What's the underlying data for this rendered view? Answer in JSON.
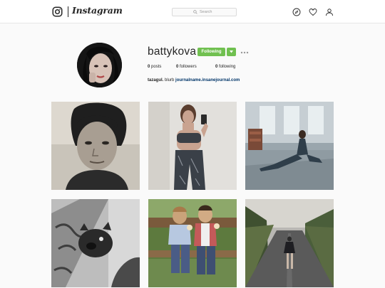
{
  "header": {
    "wordmark": "Instagram",
    "search_placeholder": "Search"
  },
  "nav": {
    "icons": [
      "compass-icon",
      "heart-icon",
      "person-icon"
    ]
  },
  "profile": {
    "username": "battykova",
    "follow_button": "Following",
    "stats": {
      "posts_count": "0",
      "posts_label": "posts",
      "followers_count": "0",
      "followers_label": "followers",
      "following_count": "0",
      "following_label": "following"
    },
    "bio": {
      "name": "tazagul.",
      "text": "blurb",
      "link": "journalname.insanejournal.com"
    }
  },
  "posts": [
    {
      "subject": "black-and-white portrait of a woman"
    },
    {
      "subject": "mirror selfie in sports bra and patterned leggings"
    },
    {
      "subject": "yoga stretch on gym floor"
    },
    {
      "subject": "tattooed arm with french bulldog"
    },
    {
      "subject": "two children eating ice cream on a bench"
    },
    {
      "subject": "woman walking down a tree-lined road"
    }
  ],
  "colors": {
    "accent_green": "#70c050",
    "link_blue": "#003569",
    "background": "#fafafa"
  }
}
